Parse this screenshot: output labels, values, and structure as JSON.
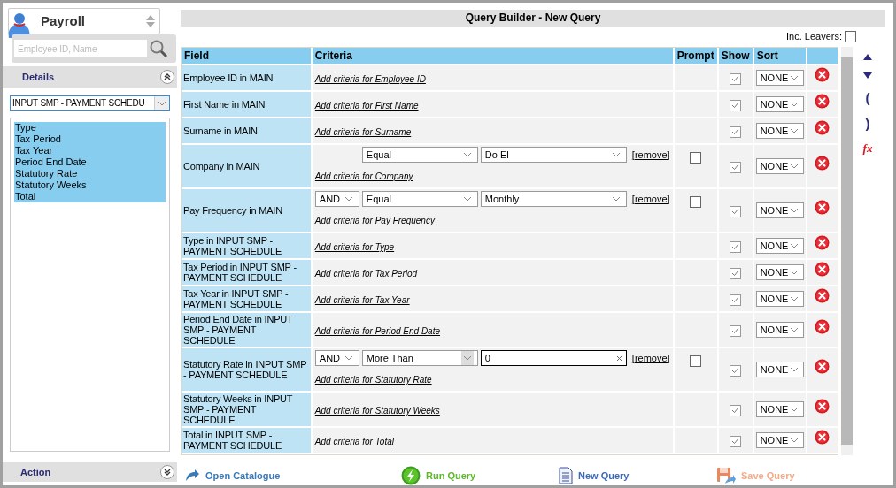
{
  "sidebar": {
    "app_title": "Payroll",
    "search": {
      "placeholder": "Employee ID, Name"
    },
    "details": {
      "title": "Details",
      "expanded": true,
      "table_select": "INPUT SMP - PAYMENT SCHEDU",
      "fields": [
        {
          "label": "Type",
          "selected": true
        },
        {
          "label": "Tax Period",
          "selected": true
        },
        {
          "label": "Tax Year",
          "selected": true
        },
        {
          "label": "Period End Date",
          "selected": true
        },
        {
          "label": "Statutory Rate",
          "selected": true
        },
        {
          "label": "Statutory Weeks",
          "selected": true
        },
        {
          "label": "Total",
          "selected": true
        }
      ]
    },
    "action": {
      "title": "Action",
      "expanded": false
    }
  },
  "main": {
    "title": "Query Builder - New Query",
    "inc_leavers": {
      "label": "Inc. Leavers:",
      "checked": false
    },
    "table": {
      "columns": [
        "Field",
        "Criteria",
        "Prompt",
        "Show",
        "Sort"
      ],
      "rows": [
        {
          "field": "Employee ID in MAIN",
          "conditions": [],
          "add_link": "Add criteria for Employee ID",
          "show": true,
          "sort": "NONE"
        },
        {
          "field": "First Name in MAIN",
          "conditions": [],
          "add_link": "Add criteria for First Name",
          "show": true,
          "sort": "NONE"
        },
        {
          "field": "Surname in MAIN",
          "conditions": [],
          "add_link": "Add criteria for Surname",
          "show": true,
          "sort": "NONE"
        },
        {
          "field": "Company in MAIN",
          "conditions": [
            {
              "operator": "Equal",
              "value": "Do El",
              "kind": "select",
              "remove": "[remove]"
            }
          ],
          "add_link": "Add criteria for Company",
          "prompt": false,
          "show": true,
          "sort": "NONE"
        },
        {
          "field": "Pay Frequency in MAIN",
          "conditions": [
            {
              "connector": "AND",
              "operator": "Equal",
              "value": "Monthly",
              "kind": "select",
              "remove": "[remove]"
            }
          ],
          "add_link": "Add criteria for Pay Frequency",
          "prompt": false,
          "show": true,
          "sort": "NONE"
        },
        {
          "field": "Type in INPUT SMP - PAYMENT SCHEDULE",
          "conditions": [],
          "add_link": "Add criteria for Type",
          "show": true,
          "sort": "NONE"
        },
        {
          "field": "Tax Period in INPUT SMP - PAYMENT SCHEDULE",
          "conditions": [],
          "add_link": "Add criteria for Tax Period",
          "show": true,
          "sort": "NONE"
        },
        {
          "field": "Tax Year in INPUT SMP - PAYMENT SCHEDULE",
          "conditions": [],
          "add_link": "Add criteria for Tax Year",
          "show": true,
          "sort": "NONE"
        },
        {
          "field": "Period End Date in INPUT SMP - PAYMENT SCHEDULE",
          "conditions": [],
          "add_link": "Add criteria for Period End Date",
          "show": true,
          "sort": "NONE"
        },
        {
          "field": "Statutory Rate in INPUT SMP - PAYMENT SCHEDULE",
          "conditions": [
            {
              "connector": "AND",
              "operator": "More Than",
              "value": "0",
              "kind": "text",
              "remove": "[remove]"
            }
          ],
          "add_link": "Add criteria for Statutory Rate",
          "prompt": false,
          "show": true,
          "sort": "NONE"
        },
        {
          "field": "Statutory Weeks in INPUT SMP - PAYMENT SCHEDULE",
          "conditions": [],
          "add_link": "Add criteria for Statutory Weeks",
          "show": true,
          "sort": "NONE"
        },
        {
          "field": "Total in INPUT SMP - PAYMENT SCHEDULE",
          "conditions": [],
          "add_link": "Add criteria for Total",
          "show": true,
          "sort": "NONE"
        }
      ]
    },
    "tools": [
      {
        "kind": "up"
      },
      {
        "kind": "down"
      },
      {
        "kind": "text",
        "label": "("
      },
      {
        "kind": "text",
        "label": ")"
      },
      {
        "kind": "function",
        "label": "fx"
      }
    ],
    "actions": [
      {
        "kind": "open",
        "label": "Open Catalogue",
        "disabled": false
      },
      {
        "kind": "run",
        "label": "Run Query",
        "disabled": false
      },
      {
        "kind": "new",
        "label": "New Query",
        "disabled": false
      },
      {
        "kind": "save",
        "label": "Save Query",
        "disabled": true
      }
    ]
  }
}
